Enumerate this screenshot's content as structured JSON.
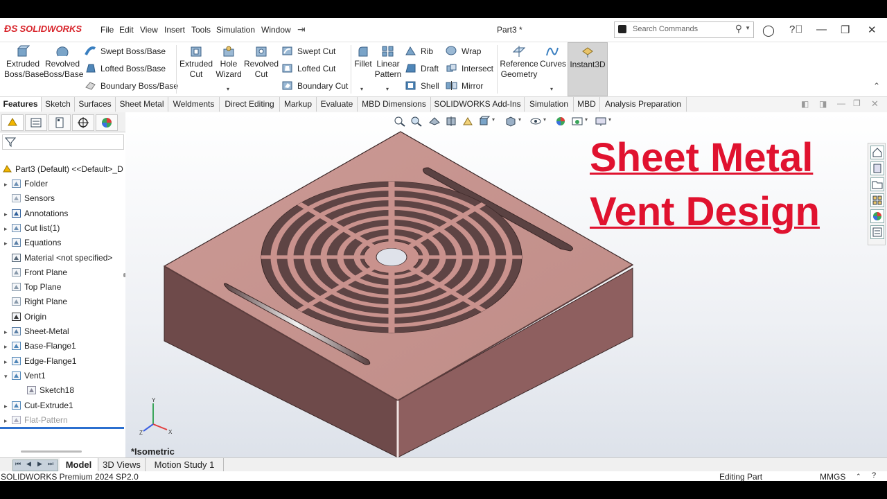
{
  "app": {
    "logo": "SOLIDWORKS",
    "doc_title": "Part3 *"
  },
  "menu": [
    "File",
    "Edit",
    "View",
    "Insert",
    "Tools",
    "Simulation",
    "Window"
  ],
  "search": {
    "placeholder": "Search Commands"
  },
  "ribbon": {
    "extruded_boss": "Extruded\nBoss/Base",
    "revolved_boss": "Revolved\nBoss/Base",
    "swept_boss": "Swept Boss/Base",
    "lofted_boss": "Lofted Boss/Base",
    "boundary_boss": "Boundary Boss/Base",
    "extruded_cut": "Extruded\nCut",
    "hole_wizard": "Hole\nWizard",
    "revolved_cut": "Revolved\nCut",
    "swept_cut": "Swept Cut",
    "lofted_cut": "Lofted Cut",
    "boundary_cut": "Boundary Cut",
    "fillet": "Fillet",
    "linear_pattern": "Linear\nPattern",
    "rib": "Rib",
    "draft": "Draft",
    "shell": "Shell",
    "wrap": "Wrap",
    "intersect": "Intersect",
    "mirror": "Mirror",
    "reference_geometry": "Reference\nGeometry",
    "curves": "Curves",
    "instant3d": "Instant3D"
  },
  "tabs": [
    "Features",
    "Sketch",
    "Surfaces",
    "Sheet Metal",
    "Weldments",
    "Direct Editing",
    "Markup",
    "Evaluate",
    "MBD Dimensions",
    "SOLIDWORKS Add-Ins",
    "Simulation",
    "MBD",
    "Analysis Preparation"
  ],
  "tree": {
    "root": "Part3 (Default) <<Default>_D",
    "items": [
      {
        "label": "Folder",
        "expand": true
      },
      {
        "label": "Sensors",
        "expand": false
      },
      {
        "label": "Annotations",
        "expand": true
      },
      {
        "label": "Cut list(1)",
        "expand": true
      },
      {
        "label": "Equations",
        "expand": true
      },
      {
        "label": "Material <not specified>",
        "expand": false
      },
      {
        "label": "Front Plane",
        "expand": false
      },
      {
        "label": "Top Plane",
        "expand": false
      },
      {
        "label": "Right Plane",
        "expand": false
      },
      {
        "label": "Origin",
        "expand": false
      },
      {
        "label": "Sheet-Metal",
        "expand": true
      },
      {
        "label": "Base-Flange1",
        "expand": true
      },
      {
        "label": "Edge-Flange1",
        "expand": true
      },
      {
        "label": "Vent1",
        "expand": "open"
      },
      {
        "label": "Sketch18",
        "expand": false,
        "indent": true
      },
      {
        "label": "Cut-Extrude1",
        "expand": true
      },
      {
        "label": "Flat-Pattern",
        "expand": true,
        "dim": true
      }
    ]
  },
  "viewport": {
    "title_line1": "Sheet Metal",
    "title_line2": "Vent  Design",
    "view_name": "*Isometric",
    "triad": {
      "x": "X",
      "y": "Y",
      "z": "Z"
    }
  },
  "bottom_tabs": [
    "Model",
    "3D Views",
    "Motion Study 1"
  ],
  "status": {
    "product": "SOLIDWORKS Premium 2024 SP2.0",
    "mode": "Editing Part",
    "units": "MMGS"
  },
  "colors": {
    "title": "#e0122f",
    "part": "#c48f8a",
    "accent": "#d8232a"
  }
}
